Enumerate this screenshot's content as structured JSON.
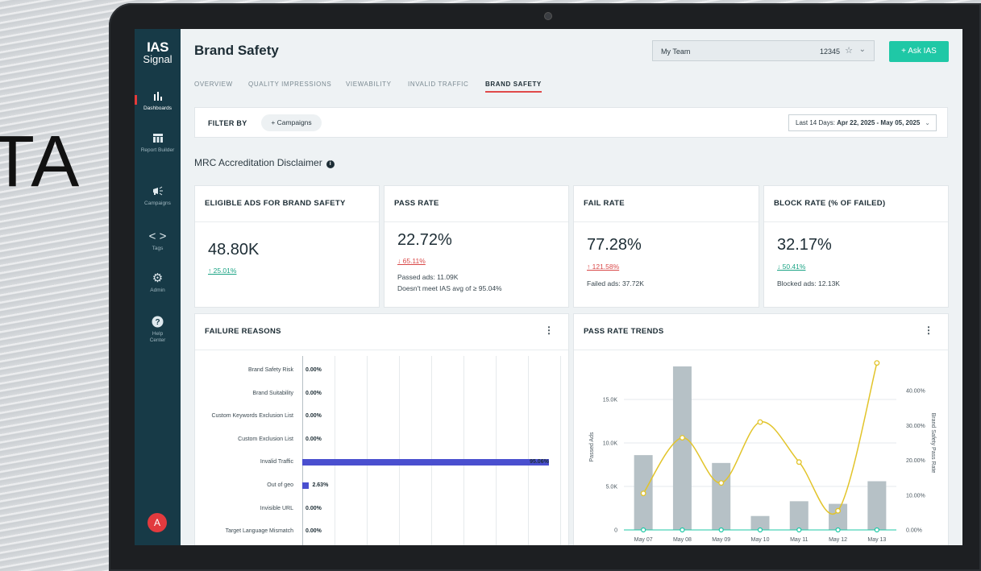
{
  "background_text": "TA",
  "sidebar": {
    "logo_line1": "IAS",
    "logo_line2": "Signal",
    "items": [
      {
        "label": "Dashboards",
        "icon": "bar-chart-icon"
      },
      {
        "label": "Report Builder",
        "icon": "table-icon"
      },
      {
        "label": "Campaigns",
        "icon": "megaphone-icon"
      },
      {
        "label": "Tags",
        "icon": "code-icon"
      },
      {
        "label": "Admin",
        "icon": "gear-icon"
      },
      {
        "label": "Help Center",
        "icon": "help-icon"
      }
    ],
    "avatar": "A"
  },
  "header": {
    "title": "Brand Safety",
    "team_name": "My Team",
    "team_id": "12345",
    "ask_button": "+ Ask IAS"
  },
  "tabs": [
    "OVERVIEW",
    "QUALITY IMPRESSIONS",
    "VIEWABILITY",
    "INVALID TRAFFIC",
    "BRAND SAFETY"
  ],
  "active_tab": "BRAND SAFETY",
  "filter": {
    "label": "FILTER BY",
    "chip": "+ Campaigns",
    "date_prefix": "Last 14 Days:",
    "date_range": "Apr 22, 2025 - May 05, 2025"
  },
  "disclaimer": "MRC Accreditation Disclaimer",
  "kpis": {
    "eligible": {
      "title": "ELIGIBLE ADS FOR BRAND SAFETY",
      "value": "48.80K",
      "delta": "↑ 25.01%"
    },
    "pass": {
      "title": "PASS RATE",
      "value": "22.72%",
      "delta": "↓ 65.11%",
      "note1": "Passed ads: 11.09K",
      "note2": "Doesn't meet IAS avg of ≥ 95.04%"
    },
    "fail": {
      "title": "FAIL RATE",
      "value": "77.28%",
      "delta": "↑ 121.58%",
      "note1": "Failed ads: 37.72K"
    },
    "block": {
      "title": "BLOCK RATE (% OF FAILED)",
      "value": "32.17%",
      "delta": "↓ 50.41%",
      "note1": "Blocked ads: 12.13K"
    }
  },
  "failure_reasons": {
    "title": "FAILURE REASONS",
    "rows": [
      {
        "label": "Brand Safety Risk",
        "value": "0.00%",
        "pct": 0
      },
      {
        "label": "Brand Suitability",
        "value": "0.00%",
        "pct": 0
      },
      {
        "label": "Custom Keywords Exclusion List",
        "value": "0.00%",
        "pct": 0
      },
      {
        "label": "Custom Exclusion List",
        "value": "0.00%",
        "pct": 0
      },
      {
        "label": "Invalid Traffic",
        "value": "95.06%",
        "pct": 95.06
      },
      {
        "label": "Out of geo",
        "value": "2.63%",
        "pct": 2.63
      },
      {
        "label": "Invisible URL",
        "value": "0.00%",
        "pct": 0
      },
      {
        "label": "Target Language Mismatch",
        "value": "0.00%",
        "pct": 0
      }
    ]
  },
  "chart_data": {
    "type": "bar",
    "title": "PASS RATE TRENDS",
    "categories": [
      "May 07",
      "May 08",
      "May 09",
      "May 10",
      "May 11",
      "May 12",
      "May 13"
    ],
    "ylabel": "Passed Ads",
    "y2label": "Brand Safety Pass Rate",
    "y_ticks": [
      "0",
      "5.0K",
      "10.0K",
      "15.0K"
    ],
    "y2_ticks": [
      "0.00%",
      "10.00%",
      "20.00%",
      "30.00%",
      "40.00%"
    ],
    "ylim": [
      0,
      20000
    ],
    "y2lim": [
      0,
      50
    ],
    "series": [
      {
        "type": "bar",
        "values": [
          8600,
          18800,
          7700,
          1600,
          3300,
          3000,
          5600
        ]
      },
      {
        "type": "line",
        "values": [
          10.5,
          26.5,
          13.5,
          31.0,
          19.5,
          5.5,
          48.0
        ]
      },
      {
        "type": "line",
        "values": [
          0,
          0,
          0,
          0,
          0,
          0,
          0
        ]
      }
    ],
    "colors": {
      "bar": "#b6c1c6",
      "line": "#e2c42a",
      "baseline": "#1fc8a6"
    }
  }
}
